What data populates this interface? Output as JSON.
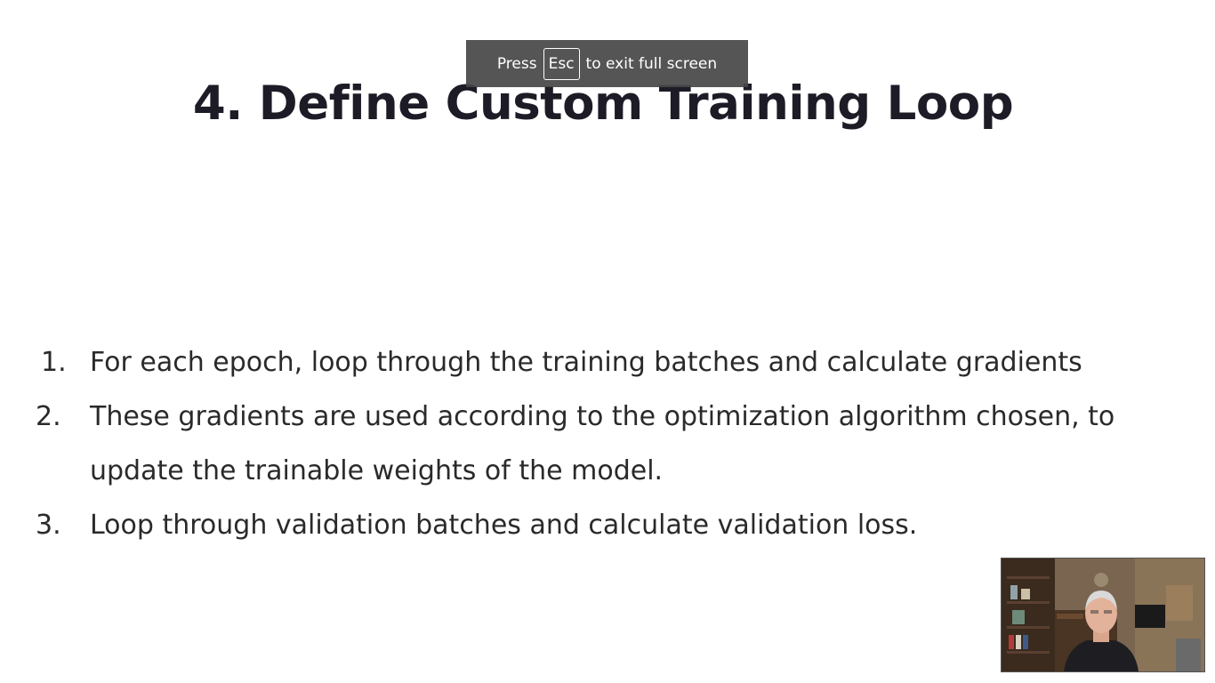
{
  "fullscreen_notice": {
    "prefix": "Press",
    "key": "Esc",
    "suffix": "to exit full screen"
  },
  "slide": {
    "title": "4. Define Custom Training Loop",
    "items": [
      {
        "number": "1.",
        "text": "For each epoch, loop through the training batches and calculate gradients"
      },
      {
        "number": "2.",
        "text": "These gradients are used according to the optimization algorithm chosen, to update the trainable weights of the model."
      },
      {
        "number": "3.",
        "text": "Loop through validation batches and calculate validation loss."
      }
    ]
  },
  "webcam": {
    "icon": "presenter-video-feed"
  }
}
